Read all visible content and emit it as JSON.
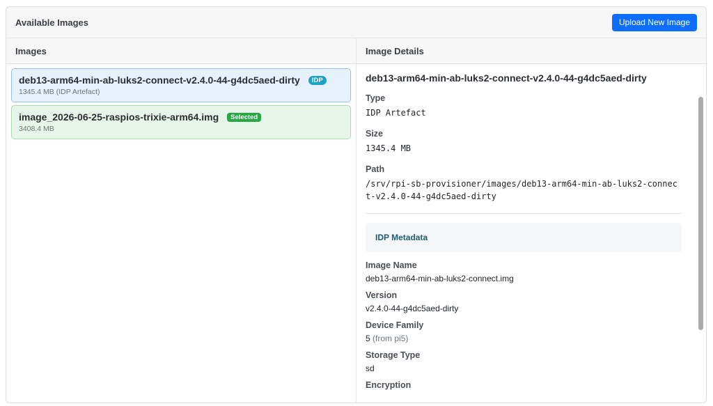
{
  "header": {
    "title": "Available Images",
    "upload_label": "Upload New Image"
  },
  "left": {
    "title": "Images",
    "items": [
      {
        "name": "deb13-arm64-min-ab-luks2-connect-v2.4.0-44-g4dc5aed-dirty",
        "badge": "IDP",
        "sub": "1345.4 MB (IDP Artefact)"
      },
      {
        "name": "image_2026-06-25-raspios-trixie-arm64.img",
        "badge": "Selected",
        "sub": "3408.4 MB"
      }
    ]
  },
  "details": {
    "header": "Image Details",
    "title": "deb13-arm64-min-ab-luks2-connect-v2.4.0-44-g4dc5aed-dirty",
    "type_label": "Type",
    "type_value": "IDP Artefact",
    "size_label": "Size",
    "size_value": "1345.4 MB",
    "path_label": "Path",
    "path_value": "/srv/rpi-sb-provisioner/images/deb13-arm64-min-ab-luks2-connect-v2.4.0-44-g4dc5aed-dirty",
    "meta_title": "IDP Metadata",
    "meta": {
      "image_name_label": "Image Name",
      "image_name_value": "deb13-arm64-min-ab-luks2-connect.img",
      "version_label": "Version",
      "version_value": "v2.4.0-44-g4dc5aed-dirty",
      "device_family_label": "Device Family",
      "device_family_value": "5",
      "device_family_note": "(from pi5)",
      "storage_type_label": "Storage Type",
      "storage_type_value": "sd",
      "encryption_label": "Encryption"
    }
  },
  "colors": {
    "accent": "#0d6efd",
    "idp_badge": "#1ba2c2",
    "selected_badge": "#28a745"
  }
}
